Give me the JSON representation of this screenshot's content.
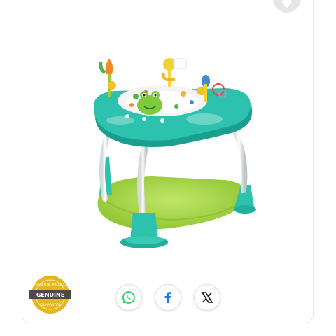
{
  "product": {
    "image_alt": "Bright Starts activity jumper",
    "colors": {
      "teal": "#2cc2ad",
      "teal_dark": "#1a9e8d",
      "lime": "#a6d83f",
      "lime_dark": "#8cc02e"
    }
  },
  "wishlist": {
    "icon": "heart-icon"
  },
  "badge": {
    "top_text": "AUTHENTIC PRODUCT",
    "main": "GENUINE",
    "bottom_text": "GUARANTEE",
    "color": "#e7b51e"
  },
  "share": [
    {
      "name": "whatsapp",
      "icon": "whatsapp-icon",
      "color": "#25d366"
    },
    {
      "name": "facebook",
      "icon": "facebook-icon",
      "color": "#1877f2"
    },
    {
      "name": "x",
      "icon": "x-icon",
      "color": "#111111"
    }
  ]
}
